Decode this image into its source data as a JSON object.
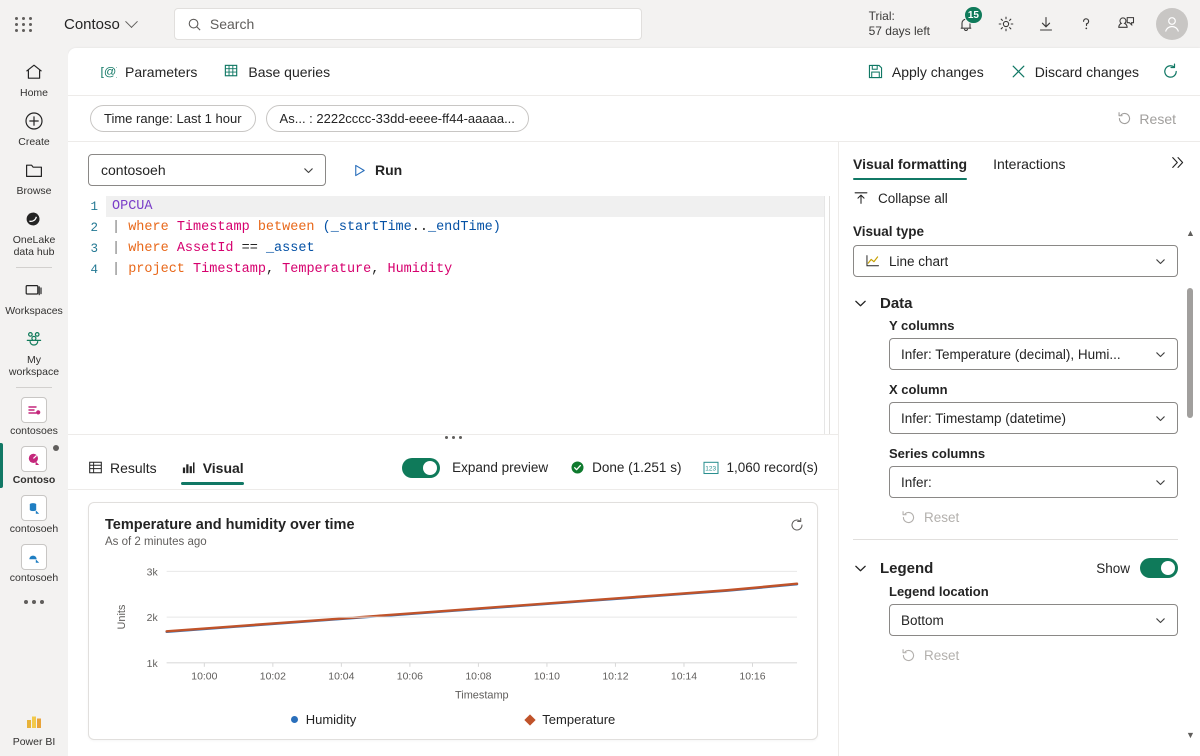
{
  "topbar": {
    "waffle_label": "app-launcher",
    "brand": "Contoso",
    "search_placeholder": "Search",
    "trial_line1": "Trial:",
    "trial_line2": "57 days left",
    "notification_count": "15"
  },
  "rail": {
    "items": [
      {
        "label": "Home",
        "icon": "home-icon"
      },
      {
        "label": "Create",
        "icon": "plus-circle-icon"
      },
      {
        "label": "Browse",
        "icon": "folder-icon"
      },
      {
        "label": "OneLake\ndata hub",
        "icon": "onelake-icon"
      },
      {
        "label": "Workspaces",
        "icon": "workspaces-icon"
      },
      {
        "label": "My\nworkspace",
        "icon": "my-workspace-icon"
      },
      {
        "label": "contosoes",
        "icon": "eventstream-icon"
      },
      {
        "label": "Contoso",
        "icon": "eventhouse-icon"
      },
      {
        "label": "contosoeh",
        "icon": "kql-database-icon"
      },
      {
        "label": "contosoeh",
        "icon": "kql-queryset-icon"
      }
    ],
    "more_label": "more-items",
    "bottom_label": "Power BI"
  },
  "command_bar": {
    "parameters": "Parameters",
    "base_queries": "Base queries",
    "apply_changes": "Apply changes",
    "discard_changes": "Discard changes",
    "refresh_label": "refresh"
  },
  "filter_bar": {
    "time_range": "Time range: Last 1 hour",
    "asset": "As... : 2222cccc-33dd-eeee-ff44-aaaaa...",
    "reset": "Reset"
  },
  "query": {
    "database": "contosoeh",
    "run": "Run",
    "lines": [
      {
        "n": "1",
        "tokens": [
          {
            "t": "OPCUA",
            "c": "kw-table"
          }
        ]
      },
      {
        "n": "2",
        "tokens": [
          {
            "t": "| ",
            "c": "pipe"
          },
          {
            "t": "where ",
            "c": "kw-op"
          },
          {
            "t": "Timestamp ",
            "c": "kw-col"
          },
          {
            "t": "between ",
            "c": "kw-op"
          },
          {
            "t": "(",
            "c": "kw-var"
          },
          {
            "t": "_startTime",
            "c": "kw-var"
          },
          {
            "t": "..",
            "c": "kw-plain"
          },
          {
            "t": "_endTime",
            "c": "kw-var"
          },
          {
            "t": ")",
            "c": "kw-var"
          }
        ]
      },
      {
        "n": "3",
        "tokens": [
          {
            "t": "| ",
            "c": "pipe"
          },
          {
            "t": "where ",
            "c": "kw-op"
          },
          {
            "t": "AssetId ",
            "c": "kw-col"
          },
          {
            "t": "== ",
            "c": "kw-plain"
          },
          {
            "t": "_asset",
            "c": "kw-var"
          }
        ]
      },
      {
        "n": "4",
        "tokens": [
          {
            "t": "| ",
            "c": "pipe"
          },
          {
            "t": "project ",
            "c": "kw-op"
          },
          {
            "t": "Timestamp",
            "c": "kw-col"
          },
          {
            "t": ", ",
            "c": "kw-plain"
          },
          {
            "t": "Temperature",
            "c": "kw-col"
          },
          {
            "t": ", ",
            "c": "kw-plain"
          },
          {
            "t": "Humidity",
            "c": "kw-col"
          }
        ]
      }
    ]
  },
  "results_bar": {
    "tab_results": "Results",
    "tab_visual": "Visual",
    "expand_preview": "Expand preview",
    "status": "Done (1.251 s)",
    "records": "1,060 record(s)"
  },
  "chart_data": {
    "type": "line",
    "title": "Temperature and humidity over time",
    "subtitle": "As of 2 minutes ago",
    "xlabel": "Timestamp",
    "ylabel": "Units",
    "xticks": [
      "10:00",
      "10:02",
      "10:04",
      "10:06",
      "10:08",
      "10:10",
      "10:12",
      "10:14",
      "10:16"
    ],
    "yticks": [
      "1k",
      "2k",
      "3k"
    ],
    "ylim": [
      1000,
      3000
    ],
    "grid": true,
    "legend_position": "bottom",
    "series": [
      {
        "name": "Humidity",
        "color": "#2a6fbb",
        "marker": "dot",
        "x": [
          "09:59",
          "10:01",
          "10:03",
          "10:05",
          "10:07",
          "10:09",
          "10:11",
          "10:13",
          "10:15",
          "10:17"
        ],
        "values": [
          1680,
          1790,
          1900,
          2010,
          2120,
          2230,
          2340,
          2450,
          2560,
          2700
        ]
      },
      {
        "name": "Temperature",
        "color": "#c0532a",
        "marker": "diamond",
        "x": [
          "09:59",
          "10:01",
          "10:03",
          "10:05",
          "10:07",
          "10:09",
          "10:11",
          "10:13",
          "10:15",
          "10:17"
        ],
        "values": [
          1690,
          1800,
          1910,
          2020,
          2130,
          2240,
          2350,
          2460,
          2570,
          2710
        ]
      }
    ]
  },
  "right_panel": {
    "tab_visual_formatting": "Visual formatting",
    "tab_interactions": "Interactions",
    "collapse_all": "Collapse all",
    "visual_type_label": "Visual type",
    "visual_type_value": "Line chart",
    "data_group": "Data",
    "y_columns_label": "Y columns",
    "y_columns_value": "Infer: Temperature (decimal), Humi...",
    "x_column_label": "X column",
    "x_column_value": "Infer: Timestamp (datetime)",
    "series_columns_label": "Series columns",
    "series_columns_value": "Infer:",
    "reset_data": "Reset",
    "legend_group": "Legend",
    "legend_show": "Show",
    "legend_location_label": "Legend location",
    "legend_location_value": "Bottom",
    "reset_legend": "Reset"
  },
  "colors": {
    "accent_teal": "#117865",
    "line_temperature": "#c0532a",
    "line_humidity": "#2a6fbb",
    "badge_green": "#0f7a5a"
  }
}
